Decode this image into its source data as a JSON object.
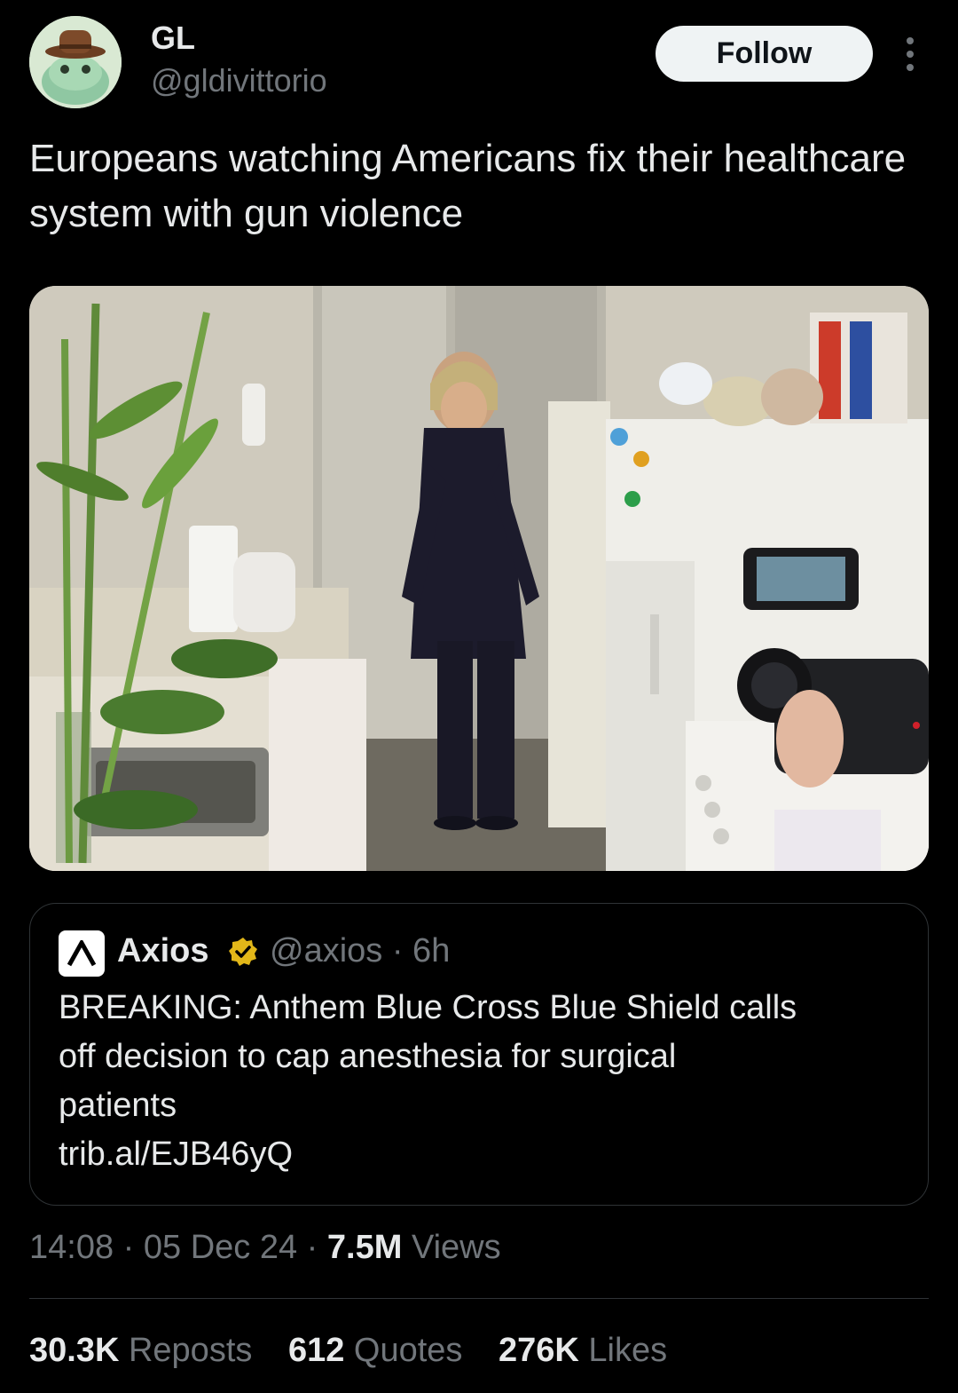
{
  "author": {
    "display_name": "GL",
    "handle": "@gldivittorio",
    "avatar_icon": "frog-with-cowboy-hat-avatar"
  },
  "follow_label": "Follow",
  "more_icon": "more-vertical-icon",
  "tweet": {
    "text": "Europeans watching Americans fix their healthcare system with gun violence"
  },
  "media": {
    "icon": "kitchen-photo"
  },
  "quoted": {
    "name": "Axios",
    "verified": true,
    "verified_color": "#e2b719",
    "handle_time": "@axios · 6h",
    "text_lines": [
      "BREAKING: Anthem Blue Cross Blue Shield calls",
      "off decision to cap anesthesia for surgical",
      "patients",
      "trib.al/EJB46yQ"
    ]
  },
  "meta": {
    "time": "14:08",
    "date": "05 Dec 24",
    "views_count": "7.5M",
    "views_label": "Views"
  },
  "stats": {
    "reposts_count": "30.3K",
    "reposts_label": "Reposts",
    "quotes_count": "612",
    "quotes_label": "Quotes",
    "likes_count": "276K",
    "likes_label": "Likes"
  },
  "colors": {
    "background": "#000000",
    "text": "#e7e9ea",
    "secondary": "#71767b",
    "border": "#2f3336"
  }
}
